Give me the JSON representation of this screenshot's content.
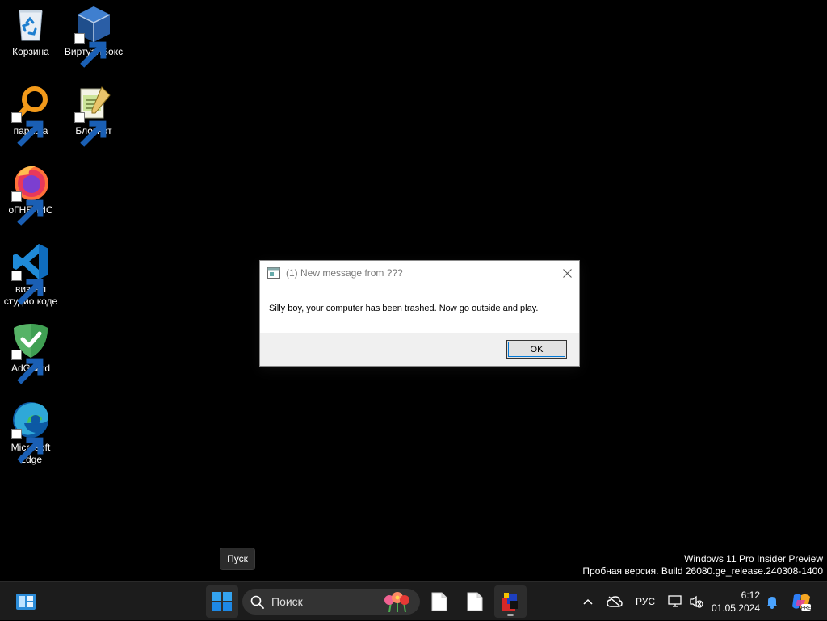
{
  "desktop": {
    "icons": [
      {
        "label": "Корзина",
        "icon": "recycle-bin-icon"
      },
      {
        "label": "ВиртуалБокс",
        "icon": "virtualbox-icon"
      },
      {
        "label": "параша",
        "icon": "search-magnifier-icon"
      },
      {
        "label": "Блокнот",
        "icon": "notepad-icon"
      },
      {
        "label": "оГНЕЛИС",
        "icon": "firefox-icon"
      },
      {
        "label": "визуал студио коде",
        "icon": "vscode-icon"
      },
      {
        "label": "AdGuard",
        "icon": "adguard-icon"
      },
      {
        "label": "Microsoft Edge",
        "icon": "edge-icon"
      }
    ]
  },
  "dialog": {
    "title": "(1) New message from ???",
    "message": "Silly boy, your computer has been trashed. Now go outside and play.",
    "ok_label": "OK"
  },
  "tooltip": {
    "text": "Пуск"
  },
  "watermark": {
    "line1": "Windows 11 Pro Insider Preview",
    "line2": "Пробная версия. Build 26080.ge_release.240308-1400"
  },
  "taskbar": {
    "search_placeholder": "Поиск",
    "language": "РУС",
    "time": "6:12",
    "date": "01.05.2024"
  },
  "colors": {
    "taskbar_bg": "#1c1c1c",
    "accent": "#0078d7",
    "dialog_bg": "#f0f0f0"
  }
}
